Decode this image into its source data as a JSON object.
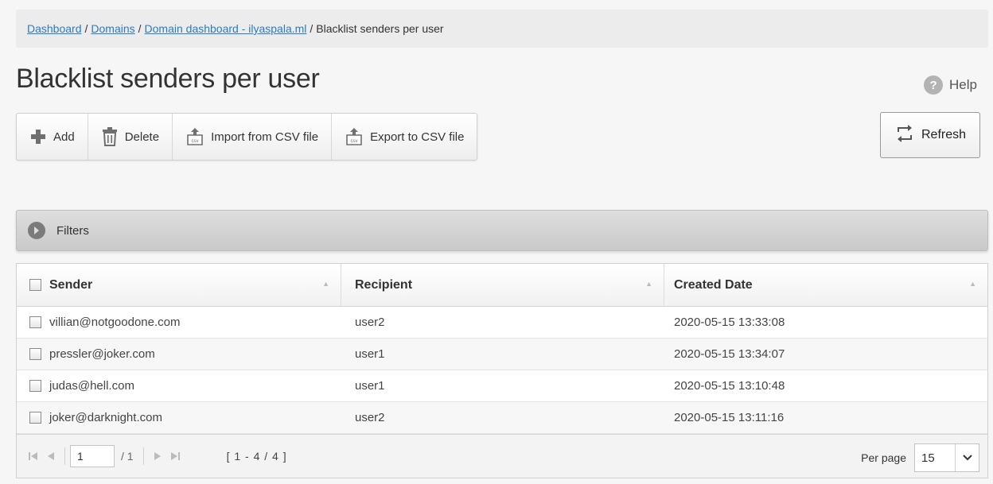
{
  "breadcrumb": {
    "dashboard": "Dashboard",
    "sep1": "/",
    "domains": "Domains",
    "sep2": "/",
    "domain_dashboard": "Domain dashboard - ilyaspala.ml",
    "sep3": "/",
    "current": "Blacklist senders per user"
  },
  "page_title": "Blacklist senders per user",
  "help_label": "Help",
  "toolbar": {
    "add_label": "Add",
    "delete_label": "Delete",
    "import_label": "Import from CSV file",
    "export_label": "Export to CSV file"
  },
  "refresh_label": "Refresh",
  "filters_label": "Filters",
  "table": {
    "columns": [
      "Sender",
      "Recipient",
      "Created Date"
    ],
    "rows": [
      {
        "sender": "villian@notgoodone.com",
        "recipient": "user2",
        "created": "2020-05-15 13:33:08"
      },
      {
        "sender": "pressler@joker.com",
        "recipient": "user1",
        "created": "2020-05-15 13:34:07"
      },
      {
        "sender": "judas@hell.com",
        "recipient": "user1",
        "created": "2020-05-15 13:10:48"
      },
      {
        "sender": "joker@darknight.com",
        "recipient": "user2",
        "created": "2020-05-15 13:11:16"
      }
    ]
  },
  "pager": {
    "page": "1",
    "total": "/ 1",
    "range": "[ 1 - 4 / 4 ]",
    "per_page_label": "Per page",
    "per_page_value": "15"
  },
  "colors": {
    "link": "#2a7bc4",
    "accent_icon": "#6f6f6f"
  },
  "icons": {
    "add": "plus-icon",
    "delete": "trash-icon",
    "import": "csv-import-icon",
    "export": "csv-export-icon",
    "refresh": "refresh-icon",
    "help": "help-icon",
    "filters": "chevron-right-circle-icon"
  }
}
